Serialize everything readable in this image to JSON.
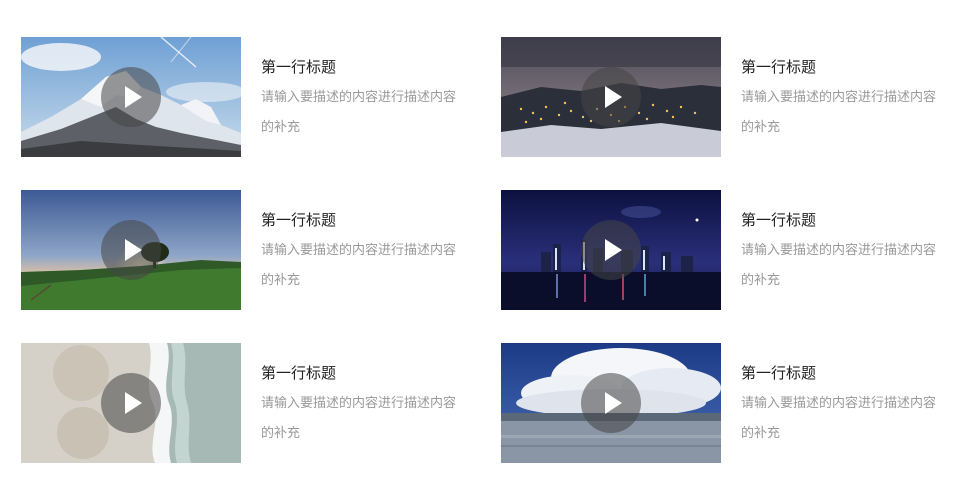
{
  "cards": [
    {
      "title": "第一行标题",
      "description": "请输入要描述的内容进行描述内容的补充",
      "thumbnail": "snowy-mountain-peak"
    },
    {
      "title": "第一行标题",
      "description": "请输入要描述的内容进行描述内容的补充",
      "thumbnail": "night-town-valley"
    },
    {
      "title": "第一行标题",
      "description": "请输入要描述的内容进行描述内容的补充",
      "thumbnail": "sunset-meadow-tree"
    },
    {
      "title": "第一行标题",
      "description": "请输入要描述的内容进行描述内容的补充",
      "thumbnail": "city-skyline-night"
    },
    {
      "title": "第一行标题",
      "description": "请输入要描述的内容进行描述内容的补充",
      "thumbnail": "aerial-beach-shore"
    },
    {
      "title": "第一行标题",
      "description": "请输入要描述的内容进行描述内容的补充",
      "thumbnail": "cumulus-clouds-sea"
    }
  ],
  "icons": {
    "play": "play-icon"
  },
  "colors": {
    "title": "#222222",
    "description": "#999999",
    "play_overlay": "#464646"
  }
}
